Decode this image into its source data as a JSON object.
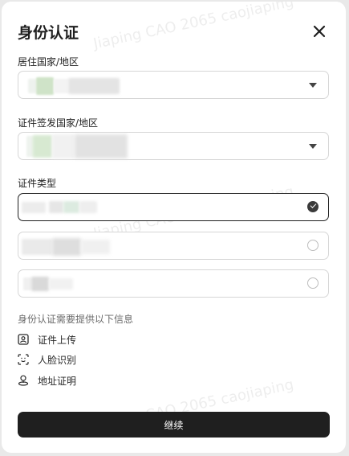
{
  "dialog": {
    "title": "身份认证",
    "close_icon": "close-icon"
  },
  "residence": {
    "label": "居住国家/地区",
    "value": ""
  },
  "issuing_country": {
    "label": "证件签发国家/地区",
    "value": ""
  },
  "document_type": {
    "label": "证件类型",
    "options": [
      {
        "label": "",
        "selected": true
      },
      {
        "label": "",
        "selected": false
      },
      {
        "label": "",
        "selected": false
      }
    ]
  },
  "requirements": {
    "title": "身份认证需要提供以下信息",
    "items": [
      {
        "icon": "id-card-icon",
        "label": "证件上传"
      },
      {
        "icon": "face-scan-icon",
        "label": "人脸识别"
      },
      {
        "icon": "location-pin-icon",
        "label": "地址证明"
      }
    ]
  },
  "actions": {
    "continue_label": "继续"
  },
  "watermark": "Jiaping CAO 2065 caojiaping"
}
